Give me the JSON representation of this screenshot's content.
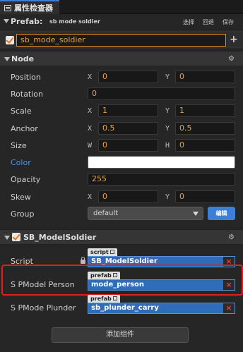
{
  "tab": {
    "title": "属性检查器"
  },
  "prefab": {
    "label": "Prefab:",
    "name": "sb mode soldier",
    "buttons": [
      "选择",
      "回退",
      "保存"
    ]
  },
  "node_name": "sb_mode_soldier",
  "node_section": {
    "title": "Node"
  },
  "node": {
    "position": {
      "label": "Position",
      "x": "0",
      "y": "0"
    },
    "rotation": {
      "label": "Rotation",
      "value": "0"
    },
    "scale": {
      "label": "Scale",
      "x": "1",
      "y": "1"
    },
    "anchor": {
      "label": "Anchor",
      "x": "0.5",
      "y": "0.5"
    },
    "size": {
      "label": "Size",
      "w": "0",
      "h": "0"
    },
    "color": {
      "label": "Color",
      "value": "#ffffff"
    },
    "opacity": {
      "label": "Opacity",
      "value": "255"
    },
    "skew": {
      "label": "Skew",
      "x": "0",
      "y": "0"
    },
    "group": {
      "label": "Group",
      "value": "default",
      "edit": "编辑"
    }
  },
  "component": {
    "title": "SB_ModelSoldier",
    "script": {
      "label": "Script",
      "tag": "script",
      "value": "SB_ModelSoldier"
    },
    "model_person": {
      "label": "S PModel Person",
      "tag": "prefab",
      "value": "mode_person"
    },
    "model_plunder": {
      "label": "S PMode Plunder",
      "tag": "prefab",
      "value": "sb_plunder_carry"
    }
  },
  "add_component": "添加组件",
  "axis": {
    "x": "X",
    "y": "Y",
    "w": "W",
    "h": "H"
  },
  "colors": {
    "accent": "#3b7fd6",
    "value_orange": "#e9a248",
    "highlight": "#e02020"
  }
}
